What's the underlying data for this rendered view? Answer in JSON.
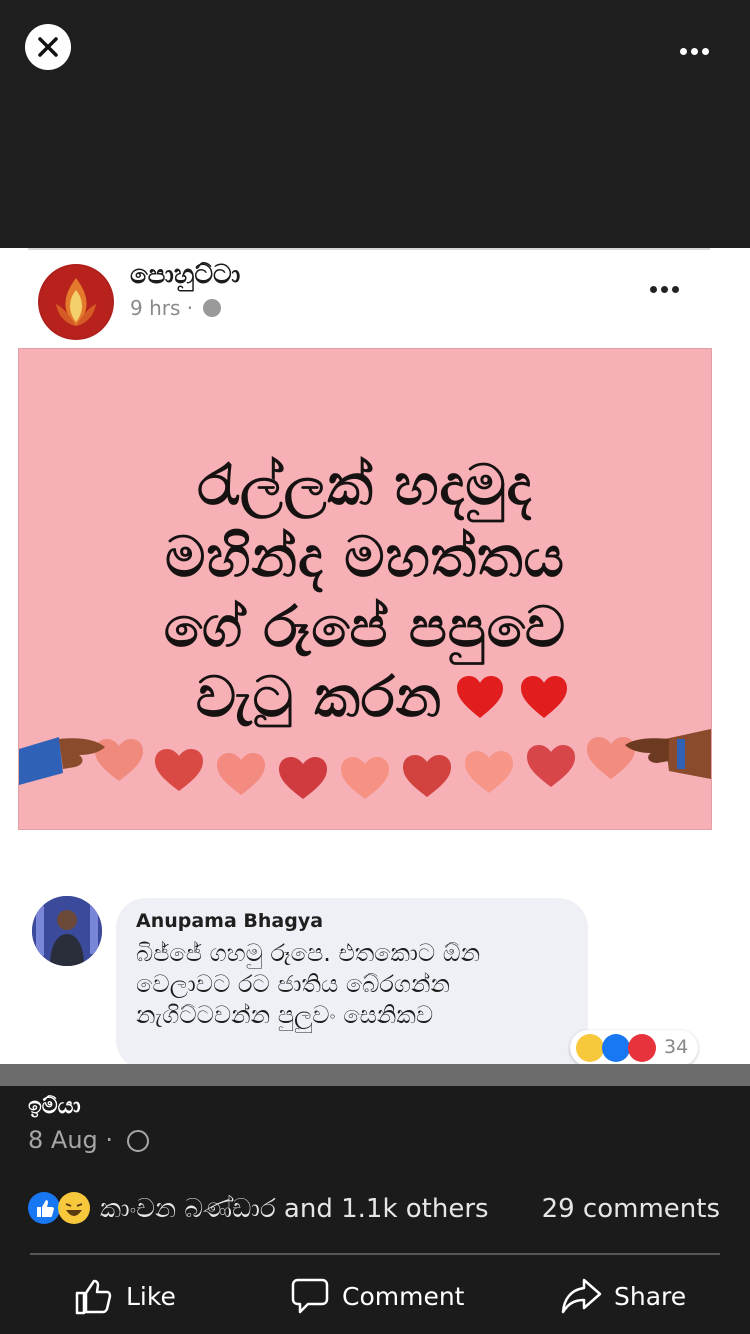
{
  "viewer": {
    "close_icon": "close-icon",
    "more_icon": "more-horizontal-icon"
  },
  "post": {
    "page_name": "පොහුට්ටා",
    "time": "9 hrs ·",
    "card_lines": [
      "රැල්ලක් හදමුද",
      "මහින්ද මහත්තය",
      "ගේ රූපේ පපුවෙ",
      "වැටු කරන"
    ],
    "comment": {
      "author": "Anupama Bhagya",
      "text": "බිජ්ජේ ගහමු රූපෙ. එතකොට ඕන වෙලාවට රට ජාතිය බේරගන්න නැගිට්ටවන්න පුලුවං සෙනිකව",
      "reaction_count": "34"
    }
  },
  "footer": {
    "author": "ඉම්යා",
    "date": "8 Aug ·",
    "reaction_summary": "කාංචන බණ්ඩාර and 1.1k others",
    "comments_count": "29 comments",
    "like_label": "Like",
    "comment_label": "Comment",
    "share_label": "Share"
  },
  "colors": {
    "card_pink": "#f6b0b6",
    "like_blue": "#1877f2",
    "haha_yellow": "#f7c83c",
    "love_red": "#e8323c"
  }
}
